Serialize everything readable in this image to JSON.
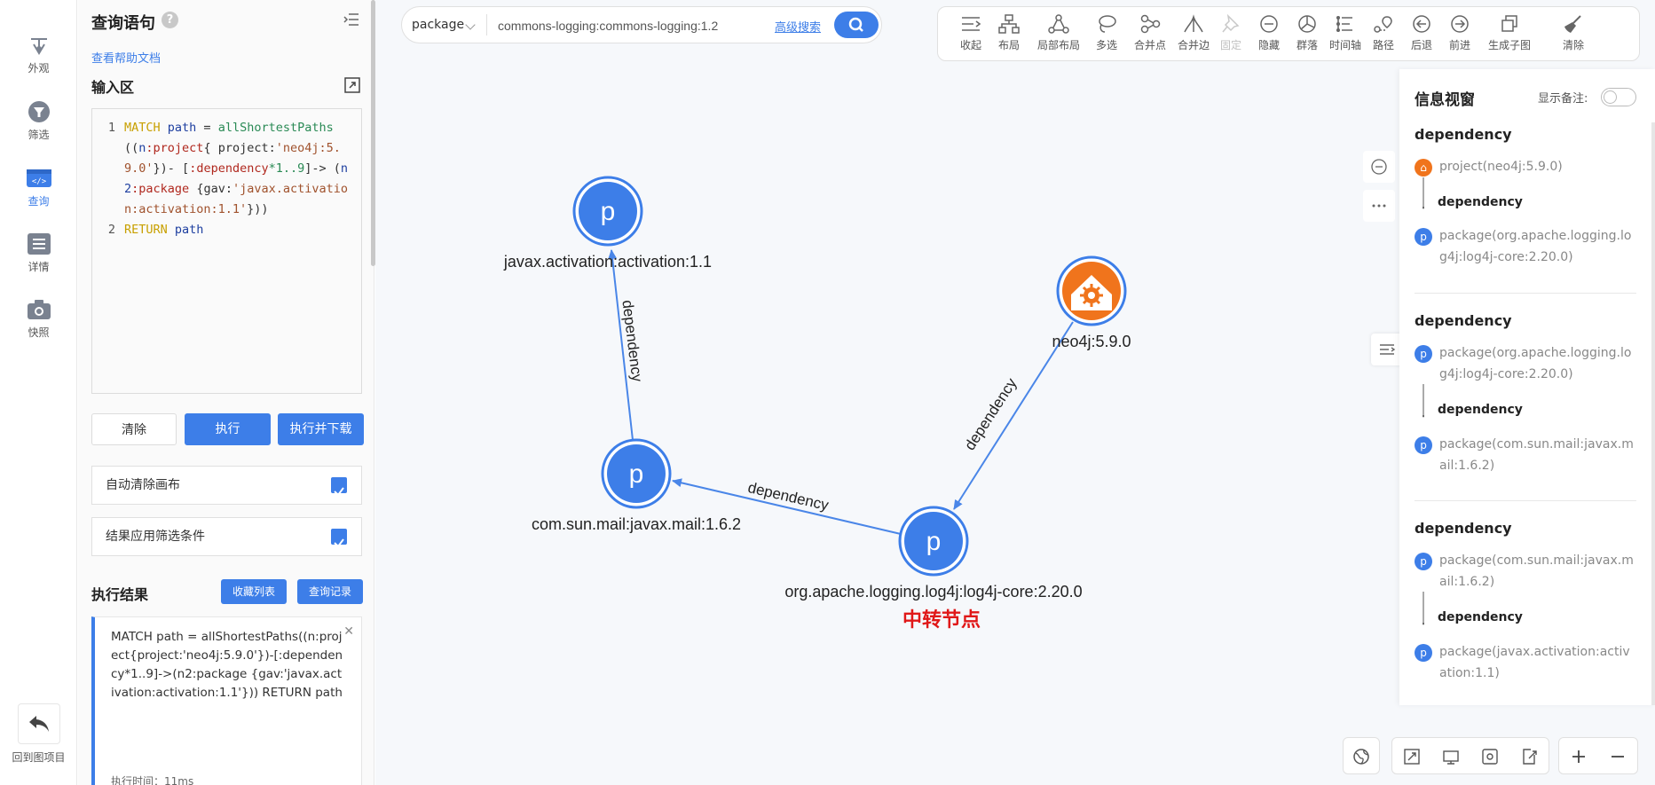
{
  "nav": {
    "items": [
      {
        "label": "外观",
        "icon": "appearance-icon"
      },
      {
        "label": "筛选",
        "icon": "filter-icon"
      },
      {
        "label": "查询",
        "icon": "code-icon"
      },
      {
        "label": "详情",
        "icon": "list-icon"
      },
      {
        "label": "快照",
        "icon": "camera-icon"
      }
    ],
    "active": "查询",
    "back_label": "回到图项目"
  },
  "query": {
    "title": "查询语句",
    "help_link": "查看帮助文档",
    "input_title": "输入区",
    "code": {
      "line1_no": "1",
      "line2_no": "2",
      "match": "MATCH",
      "path": "path",
      "eq": " =",
      "fn": "allShortestPaths",
      "p1": "((",
      "n": "n",
      "project_label": ":project",
      "brace_open": "{",
      "project_key": "project:",
      "project_val": "'neo4j:5.9.0'",
      "close1": "})-",
      "rel_open": "[",
      "rel_label": ":dependency",
      "rel_range": "*1..9",
      "rel_close": "]->",
      "p2": "(",
      "n2": "n2",
      "package_label": ":package",
      "gav_key": "{gav:",
      "gav_val": "'javax.activation:activation:1.1'",
      "close2": "}))",
      "return": "RETURN",
      "return_path": "path"
    },
    "buttons": {
      "clear": "清除",
      "execute": "执行",
      "execute_download": "执行并下载"
    },
    "options": [
      {
        "label": "自动清除画布",
        "checked": true
      },
      {
        "label": "结果应用筛选条件",
        "checked": true
      }
    ],
    "result_title": "执行结果",
    "favorites": "收藏列表",
    "history": "查询记录",
    "result_text": "MATCH path = allShortestPaths((n:project{project:'neo4j:5.9.0'})-[:dependency*1..9]->(n2:package {gav:'javax.activation:activation:1.1'})) RETURN path",
    "result_time": "执行时间：11ms"
  },
  "search": {
    "type": "package",
    "value": "commons-logging:commons-logging:1.2",
    "advanced": "高级搜索"
  },
  "toolbar": [
    {
      "label": "收起",
      "icon": "collapse-icon"
    },
    {
      "label": "布局",
      "icon": "layout-icon"
    },
    {
      "label": "局部布局",
      "icon": "local-layout-icon"
    },
    {
      "label": "多选",
      "icon": "lasso-icon"
    },
    {
      "label": "合并点",
      "icon": "merge-nodes-icon"
    },
    {
      "label": "合并边",
      "icon": "merge-edges-icon"
    },
    {
      "label": "固定",
      "icon": "pin-icon"
    },
    {
      "label": "隐藏",
      "icon": "hide-icon"
    },
    {
      "label": "群落",
      "icon": "community-icon"
    },
    {
      "label": "时间轴",
      "icon": "timeline-icon"
    },
    {
      "label": "路径",
      "icon": "path-icon"
    },
    {
      "label": "后退",
      "icon": "back-icon"
    },
    {
      "label": "前进",
      "icon": "forward-icon"
    },
    {
      "label": "生成子图",
      "icon": "subgraph-icon"
    },
    {
      "label": "清除",
      "icon": "broom-icon"
    }
  ],
  "graph": {
    "nodes": [
      {
        "id": "javax",
        "label": "javax.activation:activation:1.1",
        "glyph": "p",
        "type": "package"
      },
      {
        "id": "mail",
        "label": "com.sun.mail:javax.mail:1.6.2",
        "glyph": "p",
        "type": "package"
      },
      {
        "id": "log4j",
        "label": "org.apache.logging.log4j:log4j-core:2.20.0",
        "glyph": "p",
        "type": "package"
      },
      {
        "id": "neo4j",
        "label": "neo4j:5.9.0",
        "glyph": "",
        "type": "project"
      }
    ],
    "edges": [
      {
        "from": "neo4j",
        "to": "log4j",
        "label": "dependency"
      },
      {
        "from": "log4j",
        "to": "mail",
        "label": "dependency"
      },
      {
        "from": "mail",
        "to": "javax",
        "label": "dependency"
      }
    ],
    "annotation": "中转节点",
    "colors": {
      "package": "#3d7ee8",
      "project": "#f0741c",
      "annotation": "#e01818"
    }
  },
  "info": {
    "title": "信息视窗",
    "remark_label": "显示备注:",
    "show_remark": false,
    "sections": [
      {
        "title": "dependency",
        "from": "project(neo4j:5.9.0)",
        "from_type": "project",
        "rel": "dependency",
        "to": "package(org.apache.logging.log4j:log4j-core:2.20.0)"
      },
      {
        "title": "dependency",
        "from": "package(org.apache.logging.log4j:log4j-core:2.20.0)",
        "from_type": "package",
        "rel": "dependency",
        "to": "package(com.sun.mail:javax.mail:1.6.2)"
      },
      {
        "title": "dependency",
        "from": "package(com.sun.mail:javax.mail:1.6.2)",
        "from_type": "package",
        "rel": "dependency",
        "to": "package(javax.activation:activation:1.1)"
      }
    ]
  }
}
